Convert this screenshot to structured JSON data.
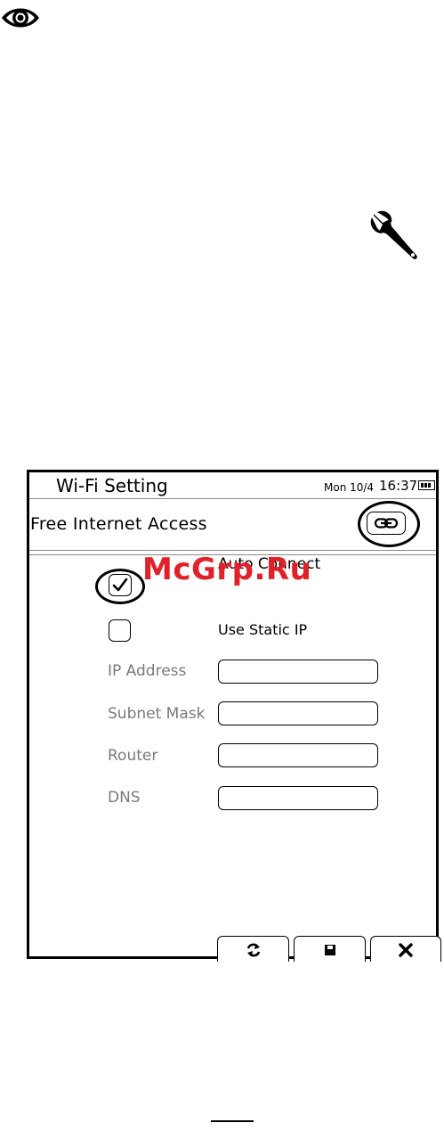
{
  "page_icons": [
    "eye-icon",
    "wrench-icon"
  ],
  "screen": {
    "title": "Wi-Fi Setting",
    "status": {
      "date": "Mon 10/4",
      "time": "16:37",
      "battery_icon": "battery-icon"
    },
    "network_name": "Free Internet Access",
    "connect_button_icon": "link-icon",
    "options": [
      {
        "label": "Auto Connect",
        "checked": true
      },
      {
        "label": "Use Static IP",
        "checked": false
      }
    ],
    "fields": [
      {
        "label": "IP Address",
        "value": ""
      },
      {
        "label": "Subnet Mask",
        "value": ""
      },
      {
        "label": "Router",
        "value": ""
      },
      {
        "label": "DNS",
        "value": ""
      }
    ],
    "bottom_buttons": [
      "refresh-icon",
      "save-icon",
      "close-icon"
    ]
  },
  "watermark": "McGrp.Ru",
  "colors": {
    "watermark": "#e0212a",
    "field_label": "#7a7a7a"
  }
}
